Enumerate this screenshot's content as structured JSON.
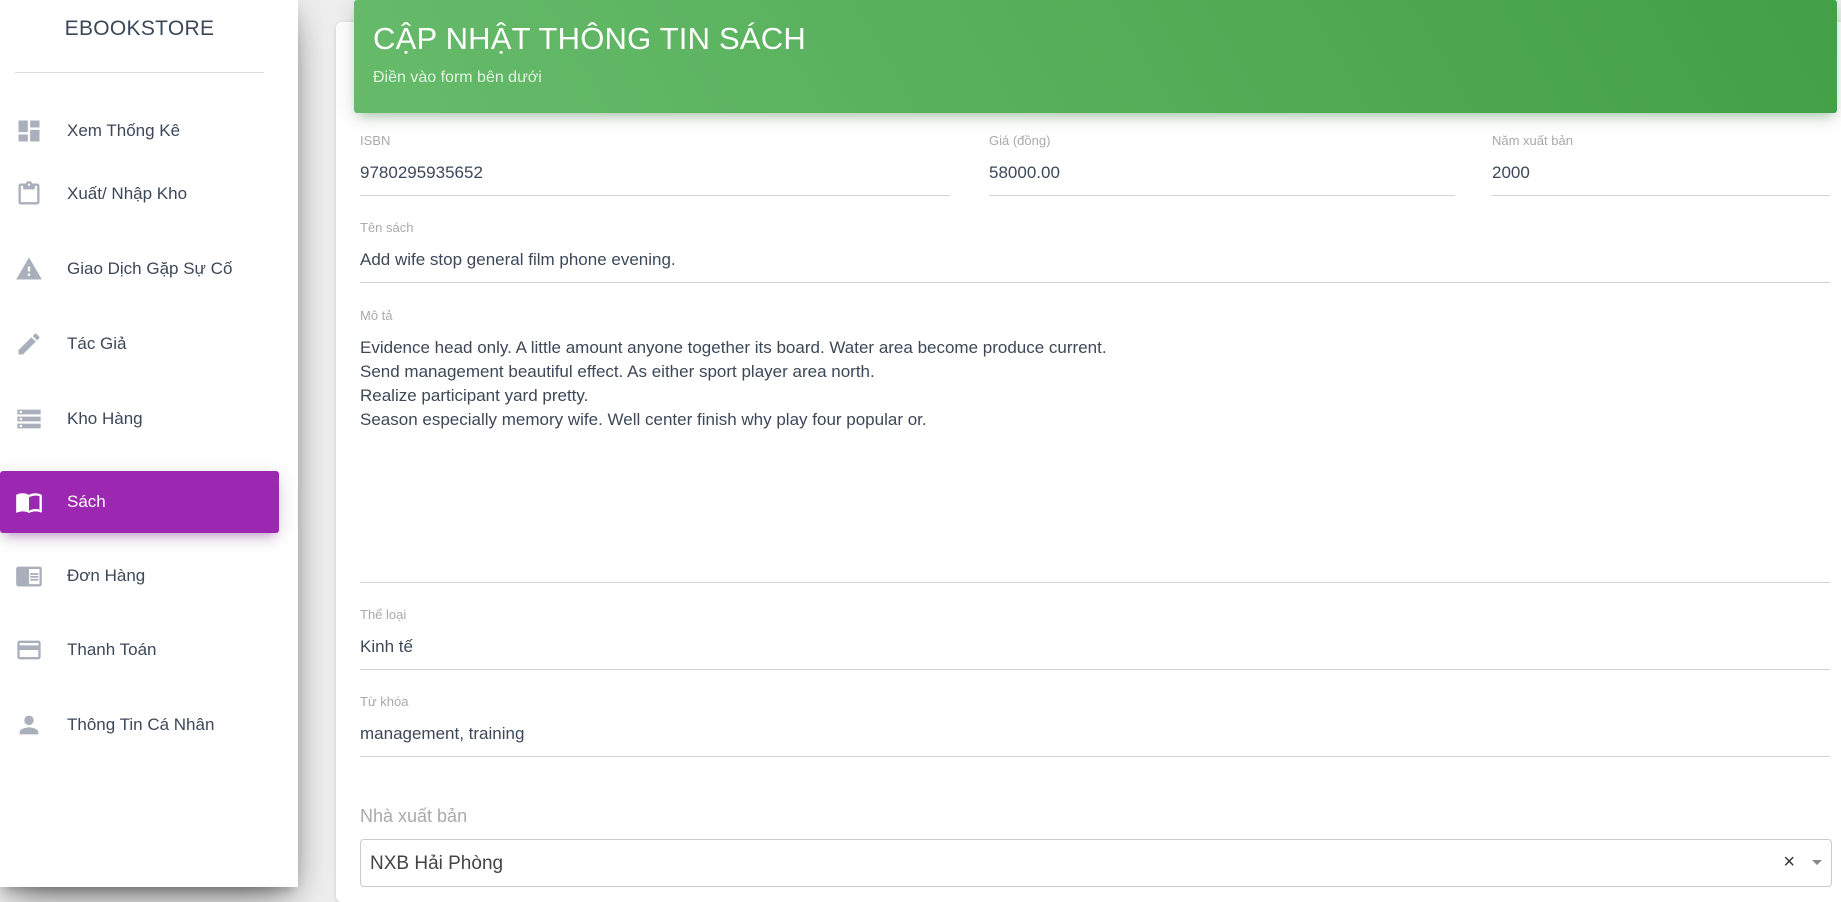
{
  "app": {
    "brand": "EBOOKSTORE"
  },
  "sidebar": {
    "items": [
      {
        "label": "Xem Thống Kê",
        "icon": "dashboard-icon",
        "active": false
      },
      {
        "label": "Xuất/ Nhập Kho",
        "icon": "clipboard-icon",
        "active": false
      },
      {
        "label": "Giao Dịch Gặp Sự Cố",
        "icon": "warning-icon",
        "active": false
      },
      {
        "label": "Tác Giả",
        "icon": "pencil-icon",
        "active": false
      },
      {
        "label": "Kho Hàng",
        "icon": "storage-icon",
        "active": false
      },
      {
        "label": "Sách",
        "icon": "book-icon",
        "active": true
      },
      {
        "label": "Đơn Hàng",
        "icon": "chrome-reader-icon",
        "active": false
      },
      {
        "label": "Thanh Toán",
        "icon": "credit-card-icon",
        "active": false
      },
      {
        "label": "Thông Tin Cá Nhân",
        "icon": "person-icon",
        "active": false
      }
    ],
    "active_color": "#9c27b0"
  },
  "header": {
    "title": "CẬP NHẬT THÔNG TIN SÁCH",
    "subtitle": "Điền vào form bên dưới",
    "color": "#4caf50"
  },
  "form": {
    "isbn": {
      "label": "ISBN",
      "value": "9780295935652"
    },
    "price": {
      "label": "Giá (đồng)",
      "value": "58000.00"
    },
    "year": {
      "label": "Năm xuất bản",
      "value": "2000"
    },
    "title": {
      "label": "Tên sách",
      "value": "Add wife stop general film phone evening."
    },
    "description": {
      "label": "Mô tả",
      "lines": [
        "Evidence head only. A little amount anyone together its board. Water area become produce current.",
        "Send management beautiful effect. As either sport player area north.",
        "Realize participant yard pretty.",
        "Season especially memory wife. Well center finish why play four popular or."
      ]
    },
    "category": {
      "label": "Thể loại",
      "value": "Kinh tế"
    },
    "keywords": {
      "label": "Từ khóa",
      "value": "management, training"
    },
    "publisher": {
      "label": "Nhà xuất bản",
      "value": "NXB Hải Phòng",
      "clear_glyph": "×"
    }
  }
}
